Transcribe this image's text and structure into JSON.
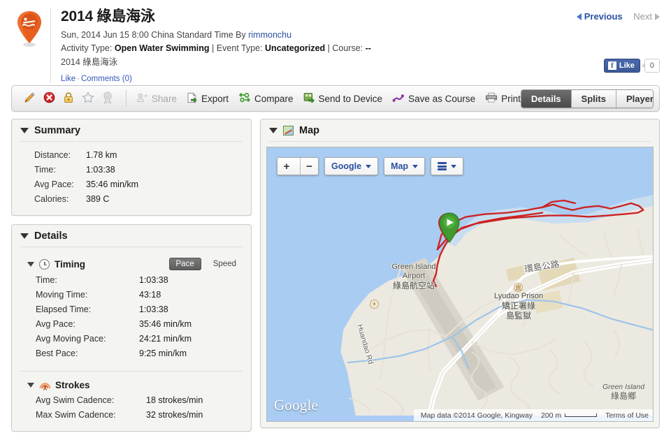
{
  "header": {
    "pin_icon": "swimmer-pin-icon",
    "title": "2014 綠島海泳",
    "date_prefix": "Sun, 2014 Jun 15 8:00 China Standard Time By ",
    "author": "rimmonchu",
    "activity_type_label": "Activity Type: ",
    "activity_type_value": "Open Water Swimming",
    "sep1": " | ",
    "event_type_label": "Event Type: ",
    "event_type_value": "Uncategorized",
    "sep2": " | ",
    "course_label": "Course: ",
    "course_value": "--",
    "description": "2014 綠島海泳",
    "like_link": "Like",
    "dot": "·",
    "comments_link": "Comments (0)",
    "previous": "Previous",
    "next": "Next",
    "facebook": {
      "like_label": "Like",
      "f_glyph": "f",
      "count": "0"
    }
  },
  "toolbar": {
    "icons": [
      {
        "name": "edit-icon",
        "title": "Edit"
      },
      {
        "name": "delete-icon",
        "title": "Delete"
      },
      {
        "name": "lock-icon",
        "title": "Privacy"
      },
      {
        "name": "star-icon",
        "title": "Favorite"
      },
      {
        "name": "award-icon",
        "title": "Award"
      }
    ],
    "actions": [
      {
        "name": "share-button",
        "label": "Share",
        "icon": "share-icon",
        "disabled": true
      },
      {
        "name": "export-button",
        "label": "Export",
        "icon": "export-icon",
        "disabled": false
      },
      {
        "name": "compare-button",
        "label": "Compare",
        "icon": "compare-icon",
        "disabled": false
      },
      {
        "name": "send-to-device-button",
        "label": "Send to Device",
        "icon": "send-device-icon",
        "disabled": false
      },
      {
        "name": "save-as-course-button",
        "label": "Save as Course",
        "icon": "course-icon",
        "disabled": false
      },
      {
        "name": "print-button",
        "label": "Print",
        "icon": "printer-icon",
        "disabled": false
      }
    ],
    "tabs": [
      {
        "label": "Details",
        "active": true
      },
      {
        "label": "Splits",
        "active": false
      },
      {
        "label": "Player",
        "active": false
      }
    ]
  },
  "summary": {
    "title": "Summary",
    "rows": [
      {
        "key": "Distance:",
        "value": "1.78 km"
      },
      {
        "key": "Time:",
        "value": "1:03:38"
      },
      {
        "key": "Avg Pace:",
        "value": "35:46 min/km"
      },
      {
        "key": "Calories:",
        "value": "389 C"
      }
    ]
  },
  "details": {
    "title": "Details",
    "timing": {
      "title": "Timing",
      "icon": "clock-icon",
      "toggle": {
        "pace": "Pace",
        "speed": "Speed",
        "active": "Pace"
      },
      "rows": [
        {
          "key": "Time:",
          "value": "1:03:38"
        },
        {
          "key": "Moving Time:",
          "value": "43:18"
        },
        {
          "key": "Elapsed Time:",
          "value": "1:03:38"
        },
        {
          "key": "Avg Pace:",
          "value": "35:46 min/km"
        },
        {
          "key": "Avg Moving Pace:",
          "value": "24:21 min/km"
        },
        {
          "key": "Best Pace:",
          "value": "9:25 min/km"
        }
      ]
    },
    "strokes": {
      "title": "Strokes",
      "icon": "cadence-icon",
      "rows": [
        {
          "key": "Avg Swim Cadence:",
          "value": "18 strokes/min"
        },
        {
          "key": "Max Swim Cadence:",
          "value": "32 strokes/min"
        }
      ]
    }
  },
  "map": {
    "title": "Map",
    "icon": "map-icon",
    "controls": {
      "zoom_in": "+",
      "zoom_out": "−",
      "provider": "Google",
      "map_type": "Map",
      "layers": "layers-icon"
    },
    "logo": "Google",
    "attribution": "Map data ©2014 Google, Kingway",
    "scale": "200 m",
    "terms": "Terms of Use",
    "labels": [
      {
        "name": "green-island-airport",
        "en": "Green Island",
        "en2": "Airport",
        "zh": "綠島航空站"
      },
      {
        "name": "lyudao-prison",
        "en": "Lyudao Prison",
        "zh1": "矯正署綠",
        "zh2": "島監獄"
      },
      {
        "name": "green-island-township",
        "en": "Green Island",
        "zh": "綠島鄉"
      }
    ],
    "roads": [
      {
        "name": "huandao-rd",
        "label": "Huandao Rd"
      },
      {
        "name": "ring-island-highway",
        "label": "環島公路"
      }
    ],
    "start_marker": "start-marker"
  }
}
